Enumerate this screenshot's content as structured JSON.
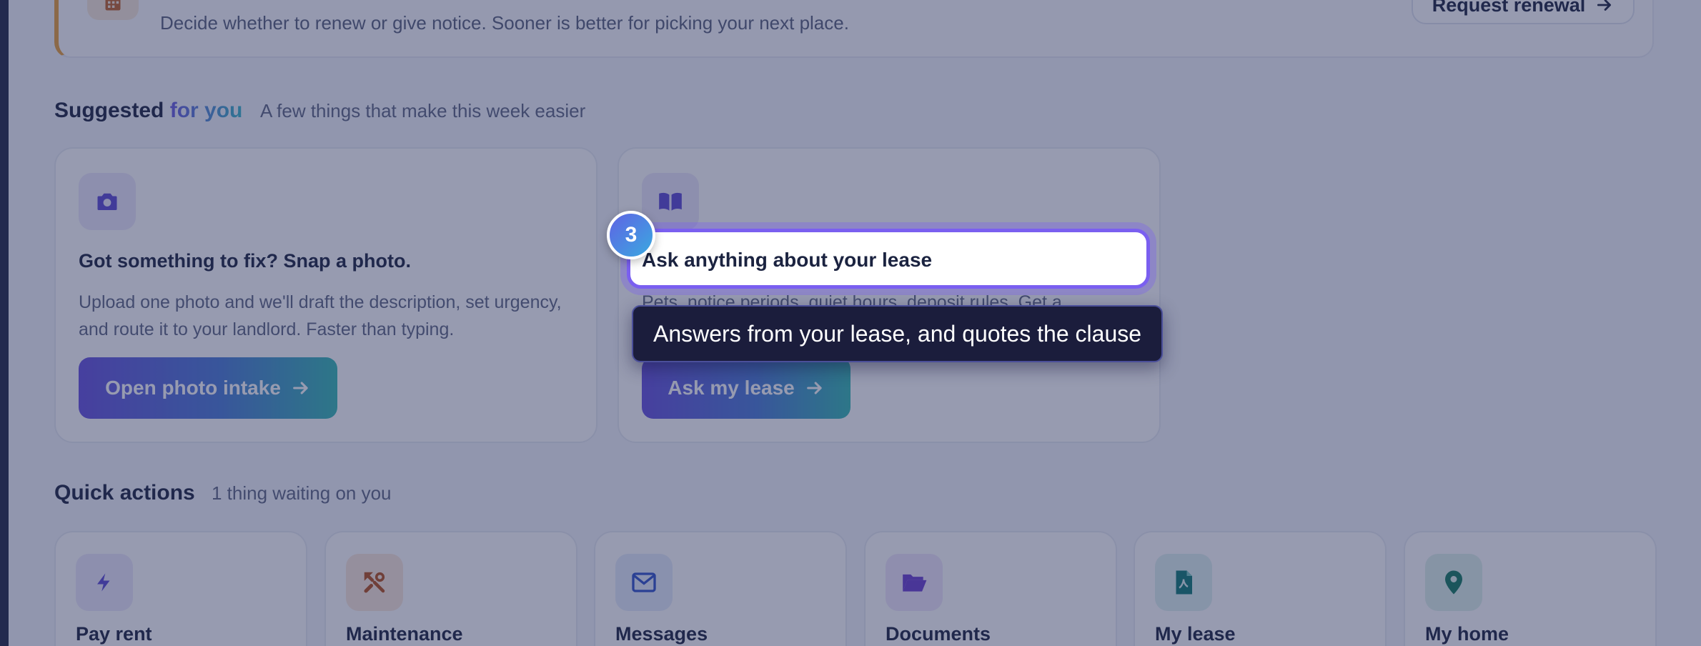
{
  "banner": {
    "description": "Decide whether to renew or give notice. Sooner is better for picking your next place.",
    "renew_label": "Request renewal"
  },
  "suggested": {
    "title_main": "Suggested",
    "title_accent": "for you",
    "subtitle": "A few things that make this week easier",
    "cards": [
      {
        "icon": "camera-icon",
        "title": "Got something to fix? Snap a photo.",
        "description": "Upload one photo and we'll draft the description, set urgency, and route it to your landlord. Faster than typing.",
        "button_label": "Open photo intake"
      },
      {
        "icon": "book-icon",
        "title": "Ask anything about your lease",
        "description": "Pets, notice periods, quiet hours, deposit rules. Get a",
        "button_label": "Ask my lease"
      }
    ]
  },
  "quick_actions": {
    "title": "Quick actions",
    "subtitle": "1 thing waiting on you",
    "items": [
      {
        "label": "Pay rent",
        "icon": "bolt-icon"
      },
      {
        "label": "Maintenance",
        "icon": "tools-icon"
      },
      {
        "label": "Messages",
        "icon": "envelope-icon"
      },
      {
        "label": "Documents",
        "icon": "folder-icon"
      },
      {
        "label": "My lease",
        "icon": "pdf-file-icon"
      },
      {
        "label": "My home",
        "icon": "map-pin-icon"
      }
    ]
  },
  "tour": {
    "step": "3",
    "highlight_text": "Ask anything about your lease",
    "tooltip": "Answers from your lease, and quotes the clause"
  },
  "colors": {
    "accent_purple": "#6650de",
    "accent_teal": "#35b9b3",
    "banner_accent": "#e9a03b",
    "overlay": "#262e5a"
  }
}
